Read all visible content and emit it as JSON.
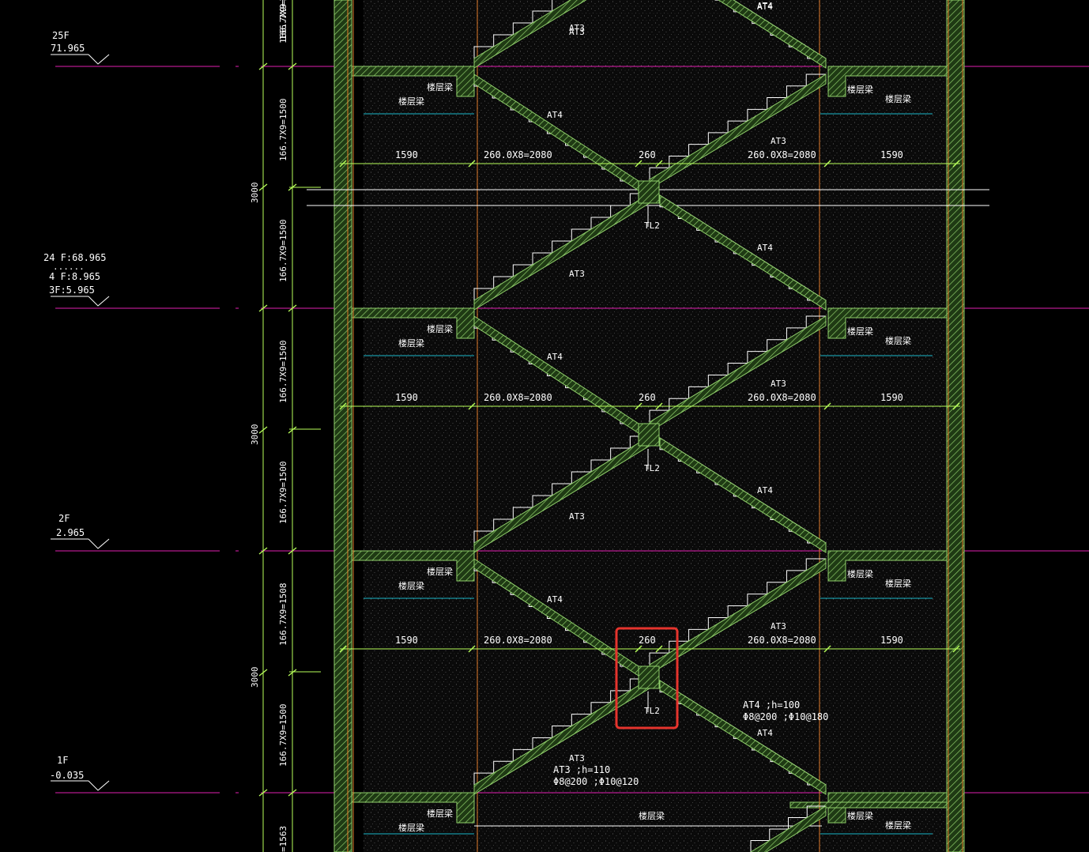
{
  "floor_levels": [
    {
      "name": "25F",
      "elevation": "71.965"
    },
    {
      "name": "24 F:68.965",
      "elevation": "4 F:8.965",
      "extra": "3F:5.965",
      "dots": "......"
    },
    {
      "name": "2F",
      "elevation": "2.965"
    },
    {
      "name": "1F",
      "elevation": "-0.035"
    }
  ],
  "vertical_dims": {
    "flight": "166.7X9=1500",
    "flight_alt": "166.7X9=1508",
    "storey": "3000",
    "bottom": "=1563"
  },
  "labels": {
    "beam": "楼层梁",
    "at3": "AT3",
    "at4": "AT4",
    "tl2": "TL2",
    "landing": "1590",
    "treads": "260.0X8=2080",
    "gap": "260"
  },
  "notes": {
    "at4_h": "AT4 ;h=100",
    "at4_rebar": "Φ8@200 ;Φ10@180",
    "at3_h": "AT3 ;h=110",
    "at3_rebar": "Φ8@200 ;Φ10@120"
  },
  "colors": {
    "background": "#000000",
    "hatch": "#8fce6a",
    "hatch_fill": "#1f3a14",
    "floor_line": "#e01fb0",
    "orange_line": "#e07a2a",
    "cyan_line": "#19b5c8",
    "white_line": "#ffffff",
    "dim_line": "#b8ff5a",
    "highlight": "#e5342d"
  }
}
